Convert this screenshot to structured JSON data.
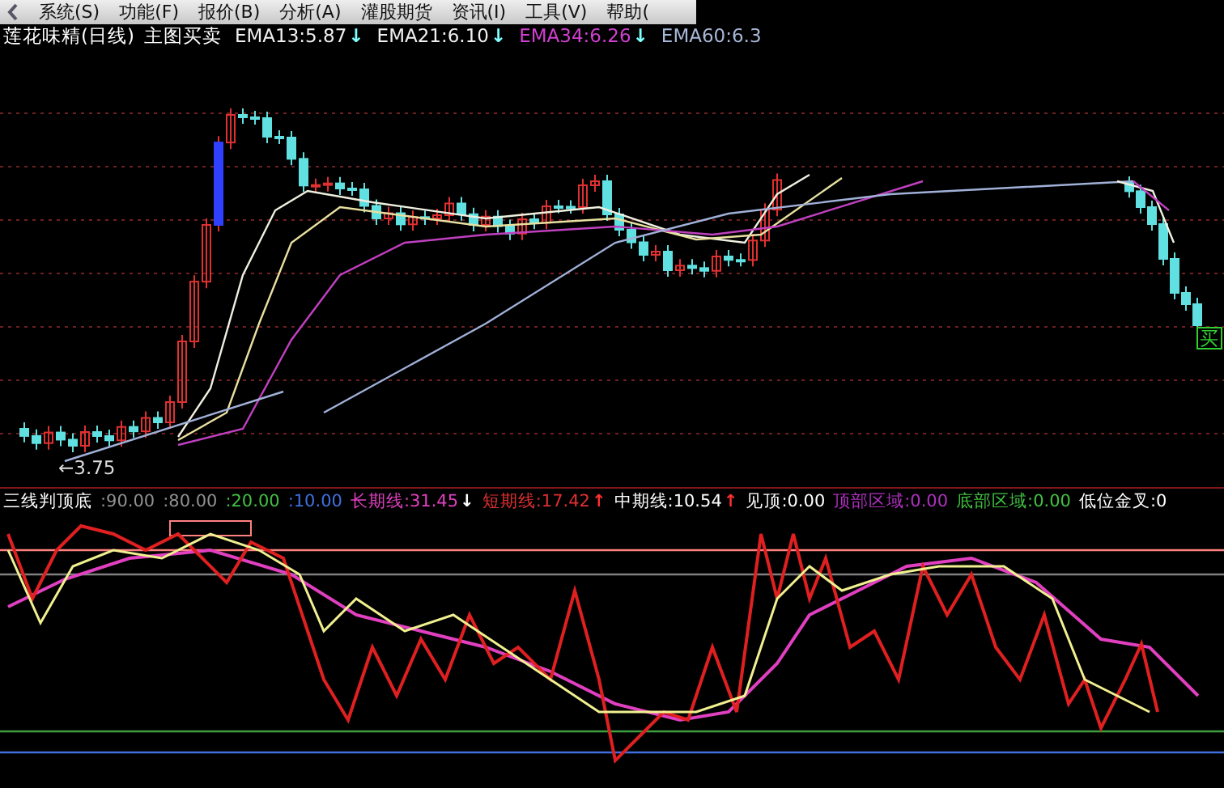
{
  "menu": [
    {
      "label": "系统(S)"
    },
    {
      "label": "功能(F)"
    },
    {
      "label": "报价(B)"
    },
    {
      "label": "分析(A)"
    },
    {
      "label": "灌股期货"
    },
    {
      "label": "资讯(I)"
    },
    {
      "label": "工具(V)"
    },
    {
      "label": "帮助("
    }
  ],
  "main_chart": {
    "title": "莲花味精(日线)",
    "subtitle": "主图买卖",
    "indicators": [
      {
        "label": "EMA13:5.87",
        "color": "#f0f0f0",
        "arrow": {
          "symbol": "↓",
          "color": "#80ffff"
        }
      },
      {
        "label": "EMA21:6.10",
        "color": "#f0f0f0",
        "arrow": {
          "symbol": "↓",
          "color": "#80ffff"
        }
      },
      {
        "label": "EMA34:6.26",
        "color": "#d040d0",
        "arrow": {
          "symbol": "↓",
          "color": "#80ffff"
        }
      },
      {
        "label": "EMA60:6.3",
        "color": "#a8b8d8"
      }
    ],
    "low_marker": "←3.75",
    "signal": "买"
  },
  "sub_chart": {
    "title": "三线判顶底",
    "indicators": [
      {
        "label": ":90.00",
        "color": "#909090"
      },
      {
        "label": ":80.00",
        "color": "#909090"
      },
      {
        "label": ":20.00",
        "color": "#40c040"
      },
      {
        "label": ":10.00",
        "color": "#4070e0"
      },
      {
        "label": "长期线:31.45",
        "color": "#e040c0",
        "arrow": {
          "symbol": "↓",
          "color": "#ffffff"
        }
      },
      {
        "label": "短期线:17.42",
        "color": "#e03030",
        "arrow": {
          "symbol": "↑",
          "color": "#ff3030"
        }
      },
      {
        "label": "中期线:10.54",
        "color": "#ffffff",
        "arrow": {
          "symbol": "↑",
          "color": "#ff3030"
        }
      },
      {
        "label": "见顶:0.00",
        "color": "#ffffff"
      },
      {
        "label": "顶部区域:0.00",
        "color": "#b030c0"
      },
      {
        "label": "底部区域:0.00",
        "color": "#40c040"
      },
      {
        "label": "低位金叉:0",
        "color": "#ffffff"
      }
    ]
  }
}
